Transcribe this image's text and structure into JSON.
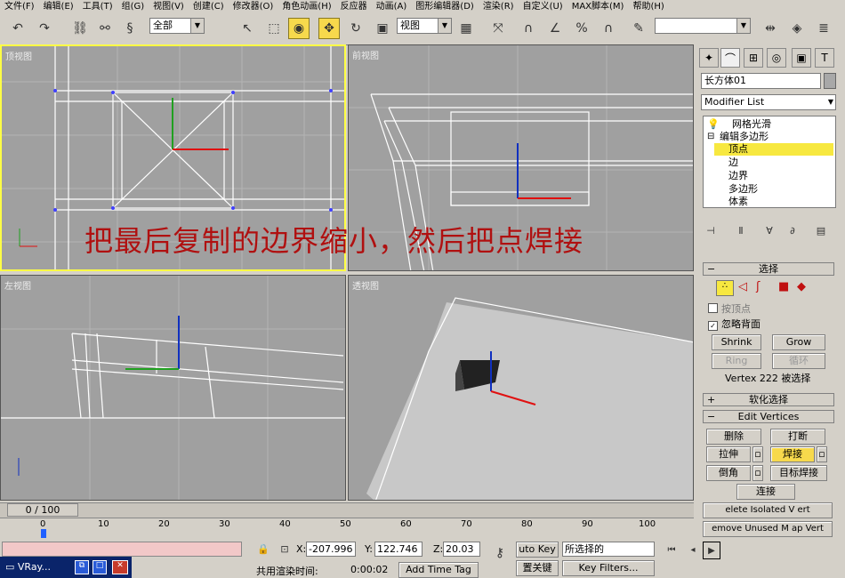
{
  "menu": [
    "文件(F)",
    "编辑(E)",
    "工具(T)",
    "组(G)",
    "视图(V)",
    "创建(C)",
    "修改器(O)",
    "角色动画(H)",
    "反应器",
    "动画(A)",
    "图形编辑器(D)",
    "渲染(R)",
    "自定义(U)",
    "MAX脚本(M)",
    "帮助(H)"
  ],
  "toolbar": {
    "selection_filter": "全部",
    "ref_coord": "视图",
    "named_selection": ""
  },
  "viewports": {
    "top": "顶视图",
    "front": "前视图",
    "left": "左视图",
    "persp": "透视图"
  },
  "overlay_text": "把最后复制的边界缩小，然后把点焊接",
  "command_panel": {
    "object_name": "长方体01",
    "modifier_list": "Modifier List",
    "stack": [
      "网格光滑",
      "编辑多边形",
      "顶点",
      "边",
      "边界",
      "多边形",
      "体素"
    ],
    "selection_title": "选择",
    "by_vertex": "按顶点",
    "ignore_backfacing": "忽略背面",
    "shrink": "Shrink",
    "grow": "Grow",
    "ring": "Ring",
    "loop": "循环",
    "status_sel": "Vertex 222 被选择",
    "soft_selection": "软化选择",
    "edit_vertices": "Edit Vertices",
    "remove": "删除",
    "break": "打断",
    "extrude": "拉伸",
    "weld": "焊接",
    "chamfer": "倒角",
    "target_weld": "目标焊接",
    "connect": "连接",
    "remove_isolated": "elete Isolated V ert",
    "remove_unused": "emove Unused M ap Vert"
  },
  "timeline": {
    "frame": "0 / 100",
    "ticks": [
      "0",
      "10",
      "20",
      "30",
      "40",
      "50",
      "60",
      "70",
      "80",
      "90",
      "100"
    ]
  },
  "status": {
    "x": "-207.996",
    "y": "122.746",
    "z": "20.03",
    "auto_key": "uto Key",
    "selected": "所选择的",
    "set_key": "置关键",
    "key_filters": "Key Filters...",
    "render_time_label": "共用渲染时间:",
    "render_time": "0:00:02",
    "add_time_tag": "Add Time Tag"
  },
  "taskbar": {
    "item": "VRay..."
  }
}
